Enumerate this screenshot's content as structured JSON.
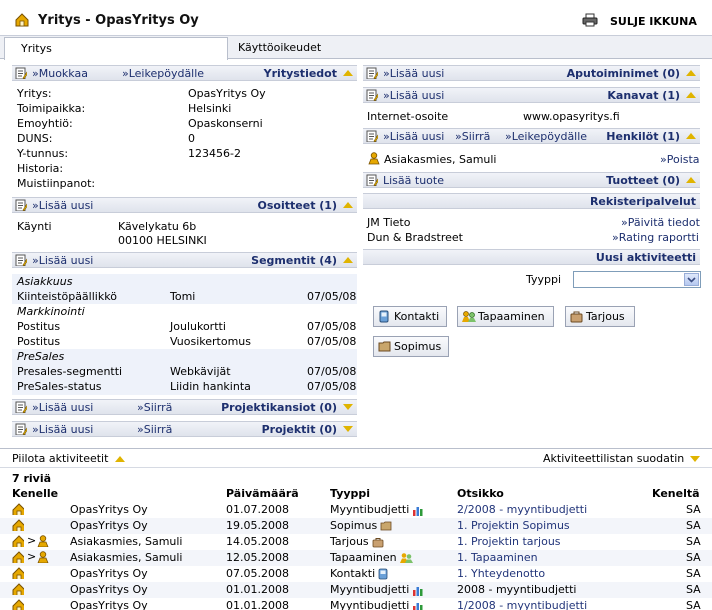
{
  "header": {
    "title": "Yritys - OpasYritys Oy",
    "close_label": "SULJE IKKUNA"
  },
  "tabs": [
    {
      "label": "Yritys",
      "active": true
    },
    {
      "label": "Käyttöoikeudet",
      "active": false
    }
  ],
  "left": {
    "yritystiedot": {
      "title": "Yritystiedot",
      "edit": "»Muokkaa",
      "clipboard": "»Leikepöydälle",
      "fields": [
        {
          "label": "Yritys:",
          "value": "OpasYritys Oy"
        },
        {
          "label": "Toimipaikka:",
          "value": "Helsinki"
        },
        {
          "label": "Emoyhtiö:",
          "value": "Opaskonserni"
        },
        {
          "label": "DUNS:",
          "value": "0"
        },
        {
          "label": "Y-tunnus:",
          "value": "123456-2"
        },
        {
          "label": "Historia:",
          "value": ""
        },
        {
          "label": "Muistiinpanot:",
          "value": ""
        }
      ]
    },
    "osoitteet": {
      "title": "Osoitteet (1)",
      "add": "»Lisää uusi",
      "type": "Käynti",
      "line1": "Kävelykatu 6b",
      "line2": "00100 HELSINKI"
    },
    "segmentit": {
      "title": "Segmentit (4)",
      "add": "»Lisää uusi",
      "groups": [
        {
          "name": "Asiakkuus",
          "rows": [
            {
              "label": "Kiinteistöpäällikkö",
              "value": "Tomi",
              "date": "07/05/08"
            }
          ]
        },
        {
          "name": "Markkinointi",
          "rows": [
            {
              "label": "Postitus",
              "value": "Joulukortti",
              "date": "07/05/08"
            },
            {
              "label": "Postitus",
              "value": "Vuosikertomus",
              "date": "07/05/08"
            }
          ]
        },
        {
          "name": "PreSales",
          "rows": [
            {
              "label": "Presales-segmentti",
              "value": "Webkävijät",
              "date": "07/05/08"
            },
            {
              "label": "PreSales-status",
              "value": "Liidin hankinta",
              "date": "07/05/08"
            }
          ]
        }
      ]
    },
    "projektikansiot": {
      "title": "Projektikansiot (0)",
      "add": "»Lisää uusi",
      "move": "»Siirrä"
    },
    "projektit": {
      "title": "Projektit (0)",
      "add": "»Lisää uusi",
      "move": "»Siirrä"
    }
  },
  "right": {
    "aputoiminimet": {
      "title": "Aputoiminimet (0)",
      "add": "»Lisää uusi"
    },
    "kanavat": {
      "title": "Kanavat (1)",
      "add": "»Lisää uusi",
      "label": "Internet-osoite",
      "value": "www.opasyritys.fi"
    },
    "henkilot": {
      "title": "Henkilöt (1)",
      "add": "»Lisää uusi",
      "move": "»Siirrä",
      "clipboard": "»Leikepöydälle",
      "person": "Asiakasmies, Samuli",
      "remove": "»Poista"
    },
    "tuotteet": {
      "title": "Tuotteet (0)",
      "add": "Lisää tuote"
    },
    "rekisteri": {
      "title": "Rekisteripalvelut",
      "rows": [
        {
          "label": "JM Tieto",
          "action": "»Päivitä tiedot"
        },
        {
          "label": "Dun & Bradstreet",
          "action": "»Rating raportti"
        }
      ]
    },
    "uudet": {
      "title": "Uusi aktiviteetti",
      "type_label": "Tyyppi",
      "select_value": "",
      "buttons": [
        "Kontakti",
        "Tapaaminen",
        "Tarjous",
        "Sopimus"
      ]
    }
  },
  "activities": {
    "hide": "Piilota aktiviteetit",
    "filter": "Aktiviteettilistan suodatin",
    "count": "7 riviä",
    "columns": [
      "Kenelle",
      "Päivämäärä",
      "Tyyppi",
      "Otsikko",
      "Keneltä"
    ],
    "rows": [
      {
        "to": "OpasYritys Oy",
        "person": false,
        "date": "01.07.2008",
        "type": "Myyntibudjetti",
        "icon": "chart",
        "title": "2/2008 - myyntibudjetti",
        "title_link": true,
        "from": "SA"
      },
      {
        "to": "OpasYritys Oy",
        "person": false,
        "date": "19.05.2008",
        "type": "Sopimus",
        "icon": "folder",
        "title": "1. Projektin Sopimus",
        "title_link": true,
        "from": "SA"
      },
      {
        "to": "Asiakasmies, Samuli",
        "person": true,
        "date": "14.05.2008",
        "type": "Tarjous",
        "icon": "bag",
        "title": "1. Projektin tarjous",
        "title_link": true,
        "from": "SA"
      },
      {
        "to": "Asiakasmies, Samuli",
        "person": true,
        "date": "12.05.2008",
        "type": "Tapaaminen",
        "icon": "people",
        "title": "1. Tapaaminen",
        "title_link": true,
        "from": "SA"
      },
      {
        "to": "OpasYritys Oy",
        "person": false,
        "date": "07.05.2008",
        "type": "Kontakti",
        "icon": "phone",
        "title": "1. Yhteydenotto",
        "title_link": true,
        "from": "SA"
      },
      {
        "to": "OpasYritys Oy",
        "person": false,
        "date": "01.01.2008",
        "type": "Myyntibudjetti",
        "icon": "chart",
        "title": "2008 - myyntibudjetti",
        "title_link": false,
        "from": "SA"
      },
      {
        "to": "OpasYritys Oy",
        "person": false,
        "date": "01.01.2008",
        "type": "Myyntibudjetti",
        "icon": "chart",
        "title": "1/2008 - myyntibudjetti",
        "title_link": true,
        "from": "SA"
      }
    ]
  },
  "colors": {
    "link": "#1d2f6e",
    "bar": "#dfe3ec",
    "accent": "#e0b400"
  }
}
